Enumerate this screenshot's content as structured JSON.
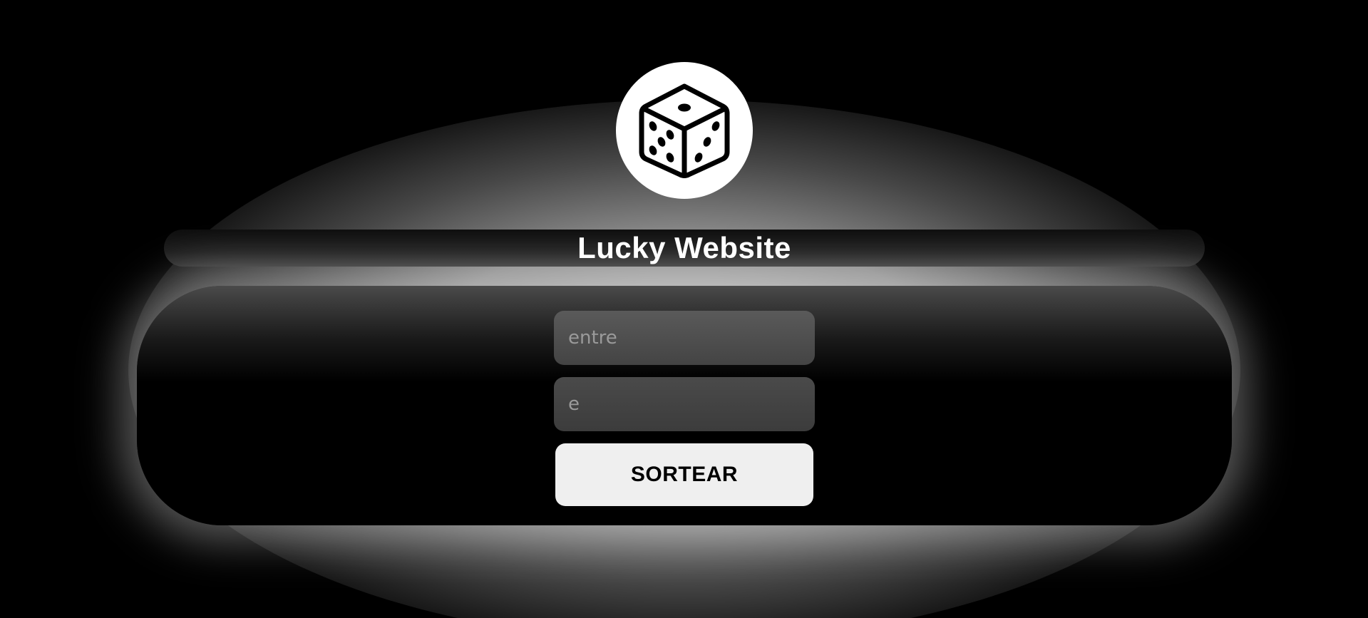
{
  "header": {
    "logo_icon": "dice-icon",
    "title": "Lucky Website"
  },
  "form": {
    "field_1_placeholder": "entre",
    "field_1_value": "",
    "field_2_placeholder": "e",
    "field_2_value": "",
    "submit_label": "SORTEAR"
  },
  "colors": {
    "background": "#000000",
    "title_text": "#ffffff",
    "button_bg": "#efefef",
    "button_text": "#000000",
    "input_bg": "#4a4a4a"
  }
}
